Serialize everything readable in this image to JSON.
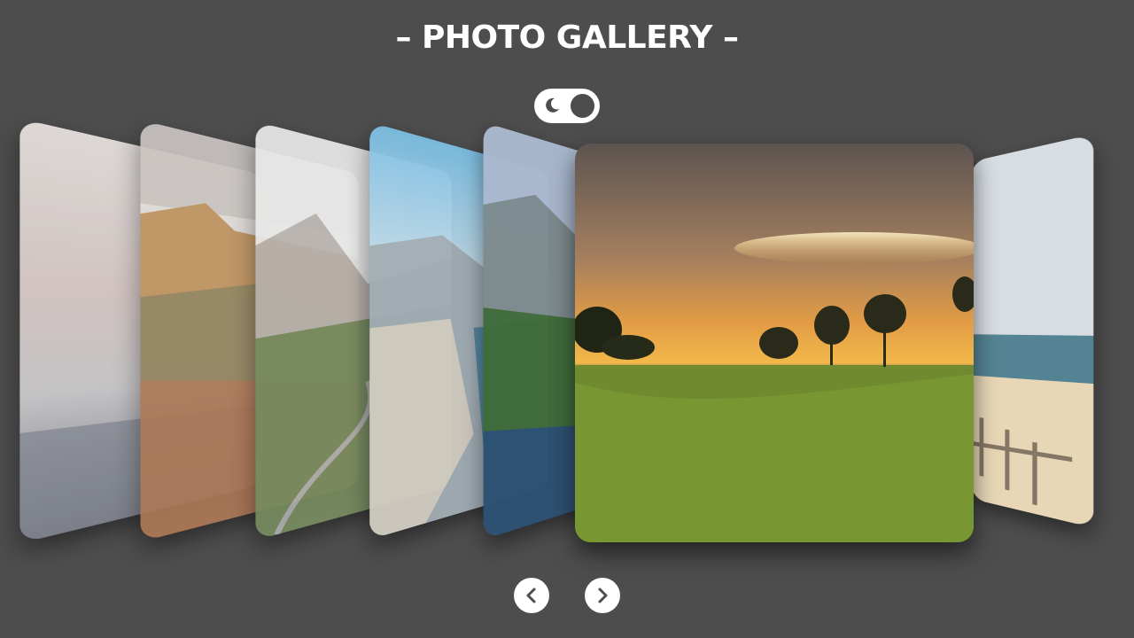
{
  "header": {
    "title": "– PHOTO GALLERY –"
  },
  "theme_toggle": {
    "icon": "moon-icon",
    "state": "dark"
  },
  "gallery": {
    "active_index": 5,
    "slides": [
      {
        "name": "sunset-sea-slide"
      },
      {
        "name": "orange-cliffs-slide"
      },
      {
        "name": "mountain-road-slide"
      },
      {
        "name": "fjord-rock-slide"
      },
      {
        "name": "forest-cliff-slide"
      },
      {
        "name": "sunset-meadow-slide"
      },
      {
        "name": "beach-pier-slide"
      }
    ]
  },
  "navigation": {
    "prev_icon": "chevron-left-icon",
    "next_icon": "chevron-right-icon"
  },
  "colors": {
    "background": "#4d4d4d",
    "foreground": "#ffffff"
  }
}
